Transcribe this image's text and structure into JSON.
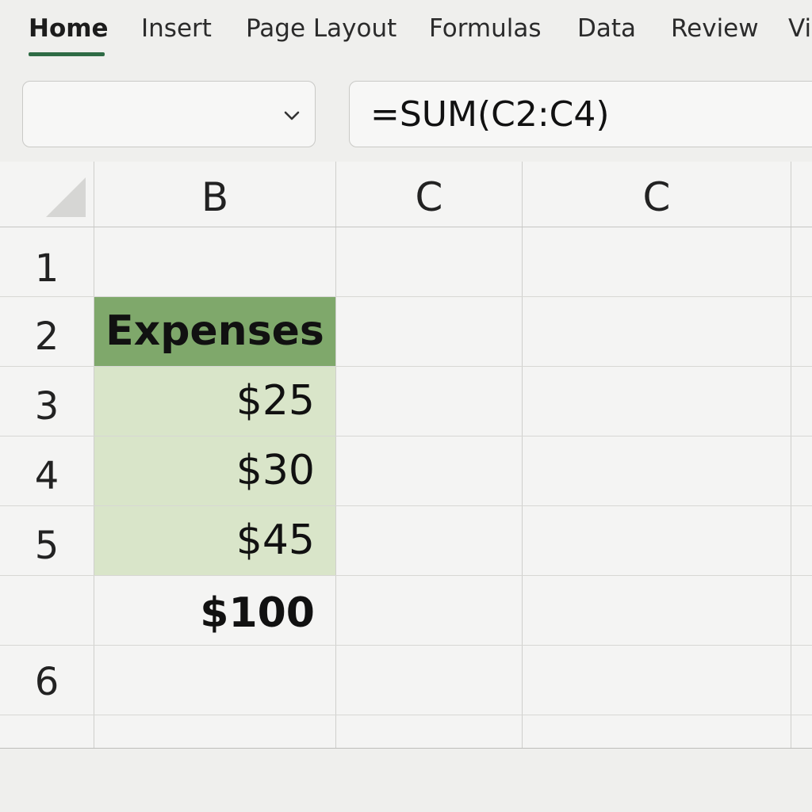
{
  "ribbon": {
    "tabs": [
      {
        "label": "Home",
        "active": true
      },
      {
        "label": "Insert"
      },
      {
        "label": "Page Layout"
      },
      {
        "label": "Formulas"
      },
      {
        "label": "Data"
      },
      {
        "label": "Review"
      },
      {
        "label": "Vi"
      }
    ],
    "accent_color": "#2e6b45"
  },
  "name_box": {
    "value": "",
    "icon": "chevron-down-icon"
  },
  "formula_bar": {
    "value": "=SUM(C2:C4)"
  },
  "sheet": {
    "column_headers": [
      "B",
      "C",
      "C"
    ],
    "row_headers": [
      "1",
      "2",
      "3",
      "4",
      "5",
      "",
      "6"
    ],
    "cells": {
      "header": "Expenses",
      "values": [
        "$25",
        "$30",
        "$45"
      ],
      "total": "$100"
    },
    "colors": {
      "header_fill": "#7fa86b",
      "value_fill": "#d9e5c9"
    }
  }
}
